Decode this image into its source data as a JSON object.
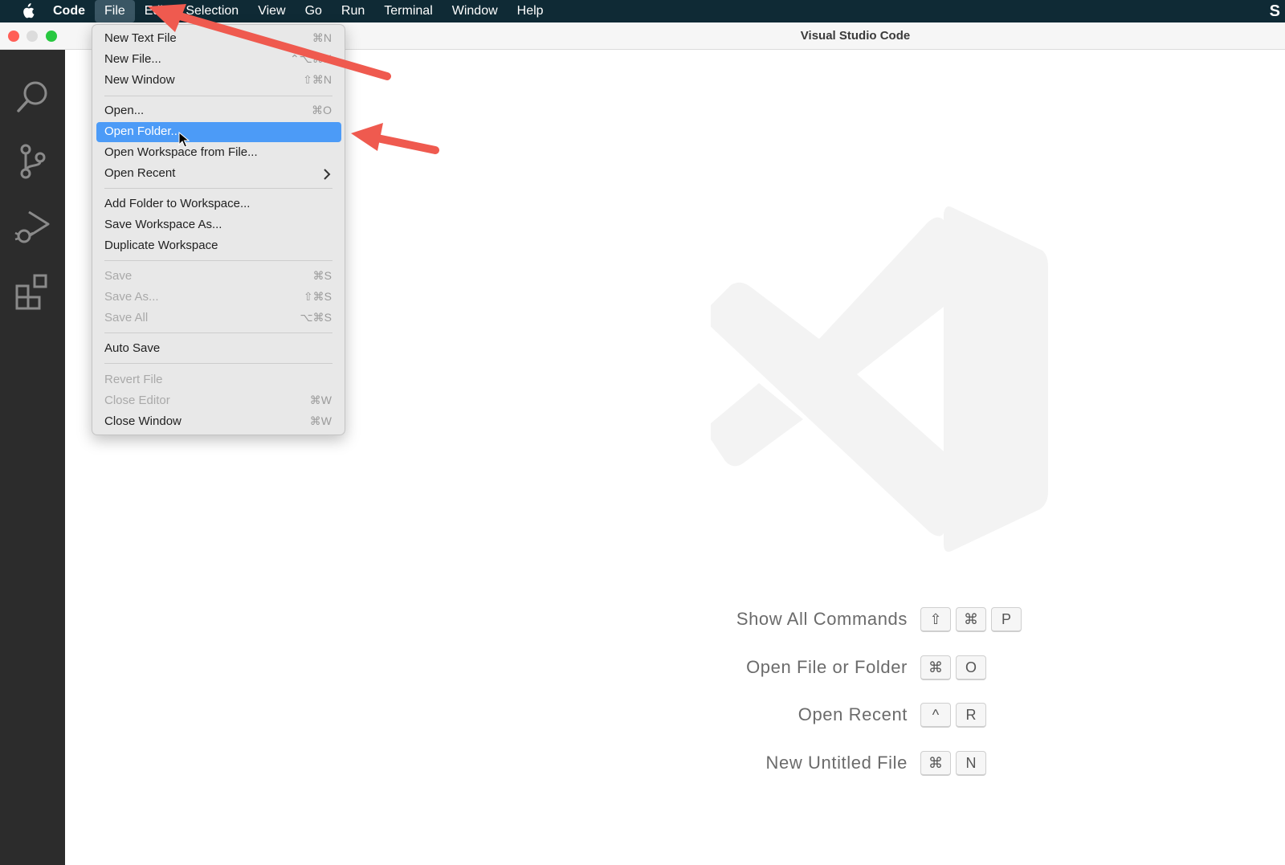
{
  "menubar": {
    "app_name": "Code",
    "items": [
      "File",
      "Edit",
      "Selection",
      "View",
      "Go",
      "Run",
      "Terminal",
      "Window",
      "Help"
    ],
    "active": "File",
    "right_icon_glyph": "S"
  },
  "window": {
    "title": "Visual Studio Code"
  },
  "activity_bar": {
    "icons": [
      "search-icon",
      "source-control-icon",
      "run-debug-icon",
      "extensions-icon"
    ]
  },
  "file_menu": {
    "items": [
      {
        "label": "New Text File",
        "shortcut": "⌘N",
        "state": "enabled"
      },
      {
        "label": "New File...",
        "shortcut": "⌃⌥⌘N",
        "state": "enabled"
      },
      {
        "label": "New Window",
        "shortcut": "⇧⌘N",
        "state": "enabled"
      },
      {
        "label": "Open...",
        "shortcut": "⌘O",
        "state": "enabled"
      },
      {
        "label": "Open Folder...",
        "shortcut": "",
        "state": "highlighted"
      },
      {
        "label": "Open Workspace from File...",
        "shortcut": "",
        "state": "enabled"
      },
      {
        "label": "Open Recent",
        "shortcut": "",
        "state": "enabled",
        "submenu": true
      },
      {
        "label": "Add Folder to Workspace...",
        "shortcut": "",
        "state": "enabled"
      },
      {
        "label": "Save Workspace As...",
        "shortcut": "",
        "state": "enabled"
      },
      {
        "label": "Duplicate Workspace",
        "shortcut": "",
        "state": "enabled"
      },
      {
        "label": "Save",
        "shortcut": "⌘S",
        "state": "disabled"
      },
      {
        "label": "Save As...",
        "shortcut": "⇧⌘S",
        "state": "disabled"
      },
      {
        "label": "Save All",
        "shortcut": "⌥⌘S",
        "state": "disabled"
      },
      {
        "label": "Auto Save",
        "shortcut": "",
        "state": "enabled"
      },
      {
        "label": "Revert File",
        "shortcut": "",
        "state": "disabled"
      },
      {
        "label": "Close Editor",
        "shortcut": "⌘W",
        "state": "disabled"
      },
      {
        "label": "Close Window",
        "shortcut": "⌘W",
        "state": "enabled"
      }
    ]
  },
  "welcome": {
    "shortcuts": [
      {
        "label": "Show All Commands",
        "keys": [
          "⇧",
          "⌘",
          "P"
        ]
      },
      {
        "label": "Open File or Folder",
        "keys": [
          "⌘",
          "O"
        ]
      },
      {
        "label": "Open Recent",
        "keys": [
          "^",
          "R"
        ]
      },
      {
        "label": "New Untitled File",
        "keys": [
          "⌘",
          "N"
        ]
      }
    ]
  },
  "colors": {
    "menubar_bg": "#0f2a35",
    "activity_bar_bg": "#2c2c2c",
    "menu_highlight": "#4c9bf7",
    "annotation_arrow": "#ef5a4f"
  }
}
